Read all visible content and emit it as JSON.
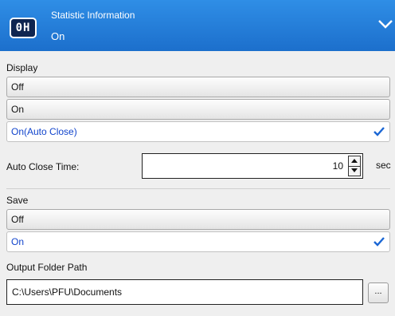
{
  "header": {
    "icon_text": "0H",
    "title": "Statistic Information",
    "value": "On"
  },
  "display": {
    "label": "Display",
    "options": [
      {
        "label": "Off"
      },
      {
        "label": "On"
      },
      {
        "label": "On(Auto Close)"
      }
    ],
    "selected": "On(Auto Close)"
  },
  "auto_close": {
    "label": "Auto Close Time:",
    "value": "10",
    "unit": "sec"
  },
  "save": {
    "label": "Save",
    "options": [
      {
        "label": "Off"
      },
      {
        "label": "On"
      }
    ],
    "selected": "On"
  },
  "output_folder": {
    "label": "Output Folder Path",
    "value": "C:\\Users\\PFU\\Documents",
    "browse_label": "..."
  },
  "colors": {
    "header": "#1c6fcc",
    "selected_text": "#1144cc",
    "check": "#1a66d4"
  }
}
